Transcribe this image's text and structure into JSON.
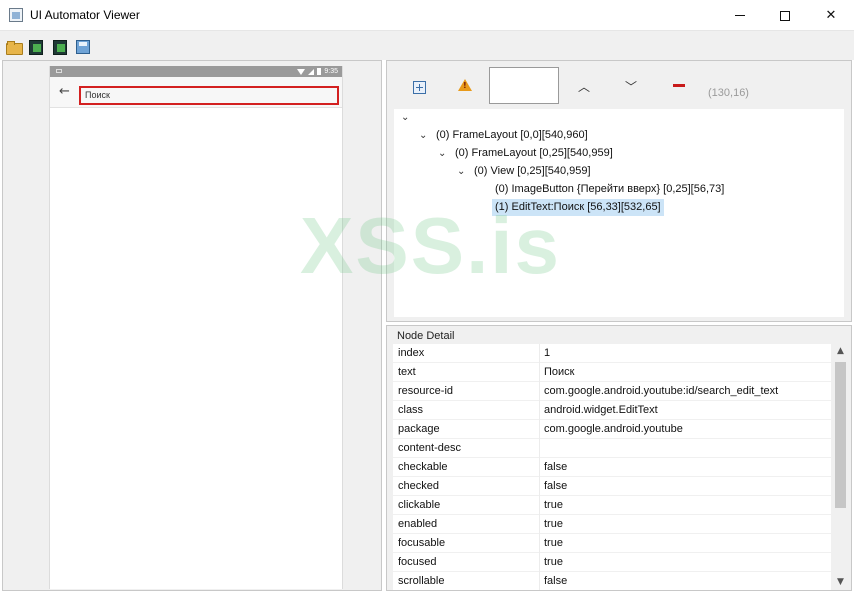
{
  "window": {
    "title": "UI Automator Viewer"
  },
  "toolbar": {
    "icons": [
      "folder-open-icon",
      "device-screenshot-icon",
      "device-screenshot-compressed-icon",
      "save-icon"
    ]
  },
  "device": {
    "status_time": "9:35",
    "search_placeholder": "Поиск",
    "back_icon": "arrow-left-icon"
  },
  "inspector": {
    "coords": "(130,16)",
    "tree": [
      {
        "label": "(0) FrameLayout [0,0][540,960]"
      },
      {
        "label": "(0) FrameLayout [0,25][540,959]"
      },
      {
        "label": "(0) View [0,25][540,959]"
      },
      {
        "label": "(0) ImageButton {Перейти вверх} [0,25][56,73]"
      },
      {
        "label": "(1) EditText:Поиск [56,33][532,65]",
        "selected": true
      }
    ]
  },
  "node_detail": {
    "title": "Node Detail",
    "rows": [
      {
        "key": "index",
        "value": "1"
      },
      {
        "key": "text",
        "value": "Поиск"
      },
      {
        "key": "resource-id",
        "value": "com.google.android.youtube:id/search_edit_text"
      },
      {
        "key": "class",
        "value": "android.widget.EditText"
      },
      {
        "key": "package",
        "value": "com.google.android.youtube"
      },
      {
        "key": "content-desc",
        "value": ""
      },
      {
        "key": "checkable",
        "value": "false"
      },
      {
        "key": "checked",
        "value": "false"
      },
      {
        "key": "clickable",
        "value": "true"
      },
      {
        "key": "enabled",
        "value": "true"
      },
      {
        "key": "focusable",
        "value": "true"
      },
      {
        "key": "focused",
        "value": "true"
      },
      {
        "key": "scrollable",
        "value": "false"
      }
    ]
  },
  "watermark": "XSS.is",
  "colors": {
    "selection": "#cce4f7",
    "highlight": "#d32020",
    "warning": "#e89a1a"
  }
}
